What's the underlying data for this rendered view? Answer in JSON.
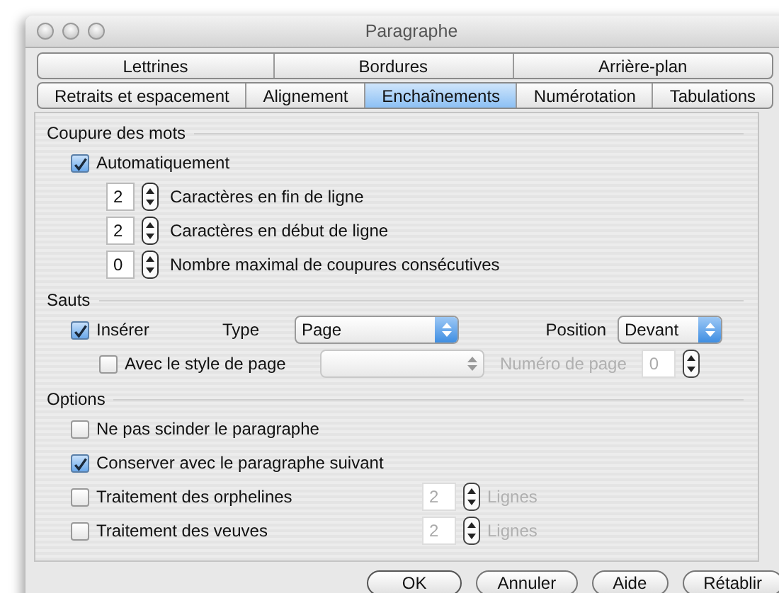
{
  "window": {
    "title": "Paragraphe"
  },
  "tab_rows": [
    [
      {
        "label": "Lettrines",
        "selected": false
      },
      {
        "label": "Bordures",
        "selected": false
      },
      {
        "label": "Arrière-plan",
        "selected": false
      }
    ],
    [
      {
        "label": "Retraits et espacement",
        "selected": false
      },
      {
        "label": "Alignement",
        "selected": false
      },
      {
        "label": "Enchaînements",
        "selected": true
      },
      {
        "label": "Numérotation",
        "selected": false
      },
      {
        "label": "Tabulations",
        "selected": false
      }
    ]
  ],
  "sections": [
    {
      "title": "Coupure des mots",
      "rows": [
        {
          "kind": "checkbox",
          "label": "Automatiquement",
          "checked": true
        },
        {
          "kind": "spinner",
          "value": "2",
          "label": "Caractères en fin de ligne"
        },
        {
          "kind": "spinner",
          "value": "2",
          "label": "Caractères en début de ligne"
        },
        {
          "kind": "spinner",
          "value": "0",
          "label": "Nombre maximal de coupures consécutives"
        }
      ]
    },
    {
      "title": "Sauts",
      "rows": [
        {
          "kind": "break",
          "label": "Insérer",
          "checked": true,
          "type_label": "Type",
          "type_value": "Page",
          "position_label": "Position",
          "position_value": "Devant"
        },
        {
          "kind": "page_style",
          "label": "Avec le style de page",
          "checked": false,
          "disabled": true,
          "number_label": "Numéro de page",
          "number_value": "0"
        }
      ]
    },
    {
      "title": "Options",
      "rows": [
        {
          "kind": "checkbox",
          "label": "Ne pas scinder le paragraphe",
          "checked": false
        },
        {
          "kind": "checkbox",
          "label": "Conserver avec le paragraphe suivant",
          "checked": true
        },
        {
          "kind": "lines",
          "label": "Traitement des orphelines",
          "checked": false,
          "value": "2",
          "unit": "Lignes",
          "disabled": true
        },
        {
          "kind": "lines",
          "label": "Traitement des veuves",
          "checked": false,
          "value": "2",
          "unit": "Lignes",
          "disabled": true
        }
      ]
    }
  ],
  "buttons": [
    {
      "label": "OK",
      "default": true
    },
    {
      "label": "Annuler",
      "default": false
    },
    {
      "label": "Aide",
      "default": false
    },
    {
      "label": "Rétablir",
      "default": false
    }
  ]
}
